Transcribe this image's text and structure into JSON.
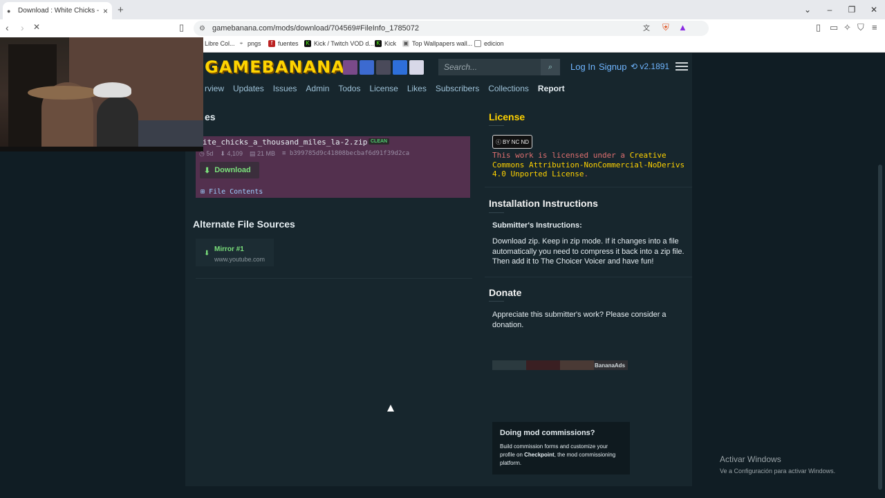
{
  "browser": {
    "tab_title": "Download : White Chicks - A Th",
    "url": "gamebanana.com/mods/download/704569#FileInfo_1785072",
    "bookmarks": [
      {
        "label": "Libre Col...",
        "icon": "folder-icon"
      },
      {
        "label": "pngs",
        "icon": "pin-icon"
      },
      {
        "label": "fuentes",
        "icon": "font-icon"
      },
      {
        "label": "Kick / Twitch VOD d...",
        "icon": "kick-icon"
      },
      {
        "label": "Kick",
        "icon": "kick-icon"
      },
      {
        "label": "Top Wallpapers wall...",
        "icon": "image-icon"
      },
      {
        "label": "edicion",
        "icon": "folder-icon"
      }
    ]
  },
  "site": {
    "logo": "GAMEBANANA",
    "search_placeholder": "Search...",
    "login": "Log In",
    "signup": "Signup",
    "version": "v2.1891",
    "subnav": [
      "rview",
      "Updates",
      "Issues",
      "Admin",
      "Todos",
      "License",
      "Likes",
      "Subscribers",
      "Collections",
      "Report"
    ]
  },
  "files": {
    "heading": "es",
    "filename": "ite_chicks_a_thousand_miles_la-2.zip",
    "badge": "CLEAN",
    "age": "5d",
    "downloads": "4,109",
    "size": "21 MB",
    "hash": "b399785d9c41808becbaf6d91f39d2ca",
    "download_label": "Download",
    "file_contents_label": "File Contents"
  },
  "alternate": {
    "heading": "Alternate File Sources",
    "mirror_label": "Mirror #1",
    "mirror_url": "www.youtube.com"
  },
  "license": {
    "heading": "License",
    "cc_badge": "BY NC ND",
    "text_prefix": "This work is licensed under a ",
    "link_text": "Creative Commons Attribution-NonCommercial-NoDerivs 4.0 Unported License",
    "text_suffix": "."
  },
  "install": {
    "heading": "Installation Instructions",
    "sub_heading": "Submitter's Instructions:",
    "body": "Download zip. Keep in zip mode. If it changes into a file automatically you need to compress it back into a zip file. Then add it to The Choicer Voicer and have fun!"
  },
  "donate": {
    "heading": "Donate",
    "body": "Appreciate this submitter's work? Please consider a donation."
  },
  "ads": {
    "label": "BananaAds"
  },
  "commission": {
    "heading": "Doing mod commissions?",
    "body_prefix": "Build commission forms and customize your profile on ",
    "brand": "Checkpoint",
    "body_suffix": ", the mod commissioning platform."
  },
  "windows": {
    "line1": "Activar Windows",
    "line2": "Ve a Configuración para activar Windows."
  },
  "colors": {
    "accent_yellow": "#ffd200",
    "link_blue": "#6fb5ff",
    "download_green": "#7be07b",
    "file_card": "#53304e"
  }
}
